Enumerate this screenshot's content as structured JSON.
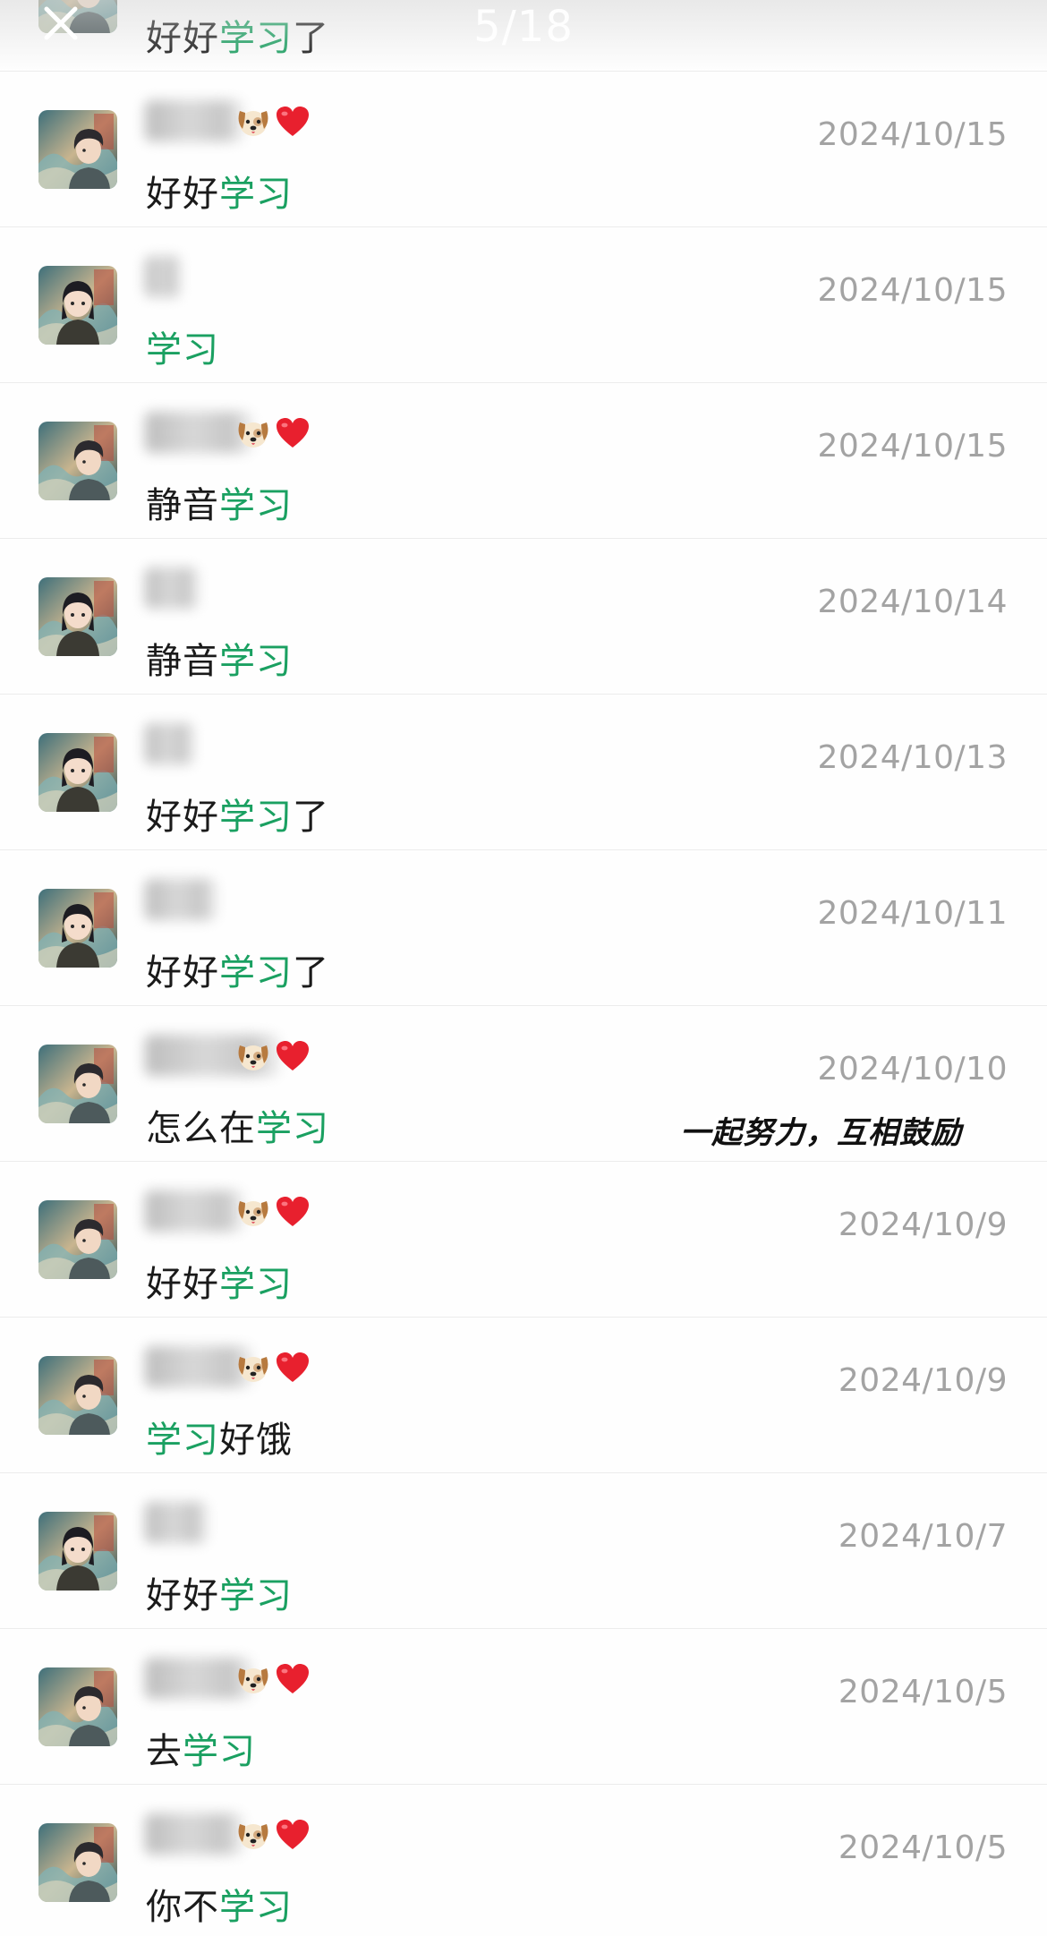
{
  "viewer": {
    "page_indicator": "5/18",
    "close_icon": "close-icon"
  },
  "caption": "一起努力，互相鼓励",
  "colors": {
    "highlight": "#1aa061",
    "date_text": "#a3a3a3",
    "message_text": "#1a1a1a",
    "divider": "#ececec"
  },
  "rows": [
    {
      "avatar": "boy",
      "emojis": false,
      "date": "",
      "msg_before": "好好",
      "msg_highlight": "学习",
      "msg_after": "了"
    },
    {
      "avatar": "boy",
      "emojis": true,
      "date": "2024/10/15",
      "msg_before": "好好",
      "msg_highlight": "学习",
      "msg_after": ""
    },
    {
      "avatar": "girl",
      "emojis": false,
      "date": "2024/10/15",
      "msg_before": "",
      "msg_highlight": "学习",
      "msg_after": ""
    },
    {
      "avatar": "boy",
      "emojis": true,
      "date": "2024/10/15",
      "msg_before": "静音",
      "msg_highlight": "学习",
      "msg_after": ""
    },
    {
      "avatar": "girl",
      "emojis": false,
      "date": "2024/10/14",
      "msg_before": "静音",
      "msg_highlight": "学习",
      "msg_after": ""
    },
    {
      "avatar": "girl",
      "emojis": false,
      "date": "2024/10/13",
      "msg_before": "好好",
      "msg_highlight": "学习",
      "msg_after": "了"
    },
    {
      "avatar": "girl",
      "emojis": false,
      "date": "2024/10/11",
      "msg_before": "好好",
      "msg_highlight": "学习",
      "msg_after": "了"
    },
    {
      "avatar": "boy",
      "emojis": true,
      "date": "2024/10/10",
      "msg_before": "怎么在",
      "msg_highlight": "学习",
      "msg_after": ""
    },
    {
      "avatar": "boy",
      "emojis": true,
      "date": "2024/10/9",
      "msg_before": "好好",
      "msg_highlight": "学习",
      "msg_after": ""
    },
    {
      "avatar": "boy",
      "emojis": true,
      "date": "2024/10/9",
      "msg_before": "",
      "msg_highlight": "学习",
      "msg_after": "好饿"
    },
    {
      "avatar": "girl",
      "emojis": false,
      "date": "2024/10/7",
      "msg_before": "好好",
      "msg_highlight": "学习",
      "msg_after": ""
    },
    {
      "avatar": "boy",
      "emojis": true,
      "date": "2024/10/5",
      "msg_before": "去",
      "msg_highlight": "学习",
      "msg_after": ""
    },
    {
      "avatar": "boy",
      "emojis": true,
      "date": "2024/10/5",
      "msg_before": "你不",
      "msg_highlight": "学习",
      "msg_after": ""
    }
  ]
}
